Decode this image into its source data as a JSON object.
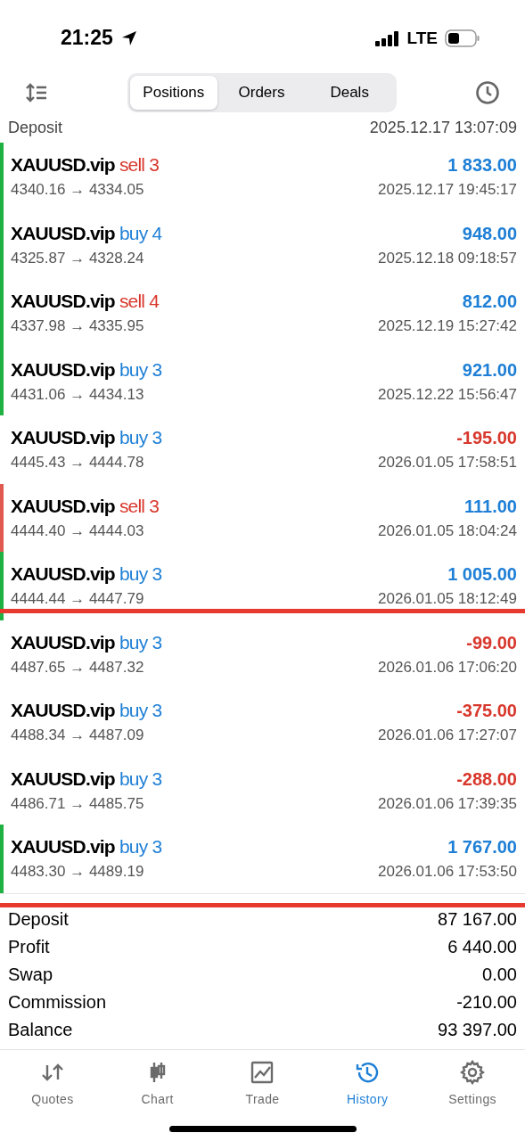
{
  "status_bar": {
    "time": "21:25",
    "network": "LTE"
  },
  "segments": [
    {
      "label": "Positions",
      "selected": true
    },
    {
      "label": "Orders",
      "selected": false
    },
    {
      "label": "Deals",
      "selected": false
    }
  ],
  "partial_row": {
    "label": "Deposit",
    "time": "2025.12.17 13:07:09"
  },
  "deals": [
    {
      "symbol": "XAUUSD.vip",
      "order": {
        "text": "sell 3",
        "kind": "sell"
      },
      "prices": "4340.16 → 4334.05",
      "profit": {
        "text": "1 833.00",
        "kind": "gain"
      },
      "time": "2025.12.17 19:45:17",
      "color": "#1fb141"
    },
    {
      "symbol": "XAUUSD.vip",
      "order": {
        "text": "buy 4",
        "kind": "buy"
      },
      "prices": "4325.87 → 4328.24",
      "profit": {
        "text": "948.00",
        "kind": "gain"
      },
      "time": "2025.12.18 09:18:57",
      "color": "#1fb141"
    },
    {
      "symbol": "XAUUSD.vip",
      "order": {
        "text": "sell 4",
        "kind": "sell"
      },
      "prices": "4337.98 → 4335.95",
      "profit": {
        "text": "812.00",
        "kind": "gain"
      },
      "time": "2025.12.19 15:27:42",
      "color": "#1fb141"
    },
    {
      "symbol": "XAUUSD.vip",
      "order": {
        "text": "buy 3",
        "kind": "buy"
      },
      "prices": "4431.06 → 4434.13",
      "profit": {
        "text": "921.00",
        "kind": "gain"
      },
      "time": "2025.12.22 15:56:47",
      "color": "#1fb141"
    },
    {
      "symbol": "XAUUSD.vip",
      "order": {
        "text": "buy 3",
        "kind": "buy"
      },
      "prices": "4445.43 → 4444.78",
      "profit": {
        "text": "-195.00",
        "kind": "loss"
      },
      "time": "2026.01.05 17:58:51"
    },
    {
      "symbol": "XAUUSD.vip",
      "order": {
        "text": "sell 3",
        "kind": "sell"
      },
      "prices": "4444.40 → 4444.03",
      "profit": {
        "text": "111.00",
        "kind": "gain"
      },
      "time": "2026.01.05 18:04:24",
      "color": "#e05a4f"
    },
    {
      "symbol": "XAUUSD.vip",
      "order": {
        "text": "buy 3",
        "kind": "buy"
      },
      "prices": "4444.44 → 4447.79",
      "profit": {
        "text": "1 005.00",
        "kind": "gain"
      },
      "time": "2026.01.05 18:12:49",
      "color": "#1fb141",
      "annotation": {
        "kind": "over"
      }
    },
    {
      "symbol": "XAUUSD.vip",
      "order": {
        "text": "buy 3",
        "kind": "buy"
      },
      "prices": "4487.65 → 4487.32",
      "profit": {
        "text": "-99.00",
        "kind": "loss"
      },
      "time": "2026.01.06 17:06:20"
    },
    {
      "symbol": "XAUUSD.vip",
      "order": {
        "text": "buy 3",
        "kind": "buy"
      },
      "prices": "4488.34 → 4487.09",
      "profit": {
        "text": "-375.00",
        "kind": "loss"
      },
      "time": "2026.01.06 17:27:07"
    },
    {
      "symbol": "XAUUSD.vip",
      "order": {
        "text": "buy 3",
        "kind": "buy"
      },
      "prices": "4486.71 → 4485.75",
      "profit": {
        "text": "-288.00",
        "kind": "loss"
      },
      "time": "2026.01.06 17:39:35"
    },
    {
      "symbol": "XAUUSD.vip",
      "order": {
        "text": "buy 3",
        "kind": "buy"
      },
      "prices": "4483.30 → 4489.19",
      "profit": {
        "text": "1 767.00",
        "kind": "gain"
      },
      "time": "2026.01.06 17:53:50",
      "color": "#1fb141",
      "annotation": {
        "kind": "under"
      }
    }
  ],
  "summary": [
    {
      "label": "Deposit",
      "value": "87 167.00"
    },
    {
      "label": "Profit",
      "value": "6 440.00"
    },
    {
      "label": "Swap",
      "value": "0.00"
    },
    {
      "label": "Commission",
      "value": "-210.00"
    },
    {
      "label": "Balance",
      "value": "93 397.00"
    }
  ],
  "tab_bar": [
    {
      "label": "Quotes",
      "kind": "quotes",
      "selected": false
    },
    {
      "label": "Chart",
      "kind": "chart",
      "selected": false
    },
    {
      "label": "Trade",
      "kind": "trade",
      "selected": false
    },
    {
      "label": "History",
      "kind": "history",
      "selected": true
    },
    {
      "label": "Settings",
      "kind": "settings",
      "selected": false
    }
  ]
}
